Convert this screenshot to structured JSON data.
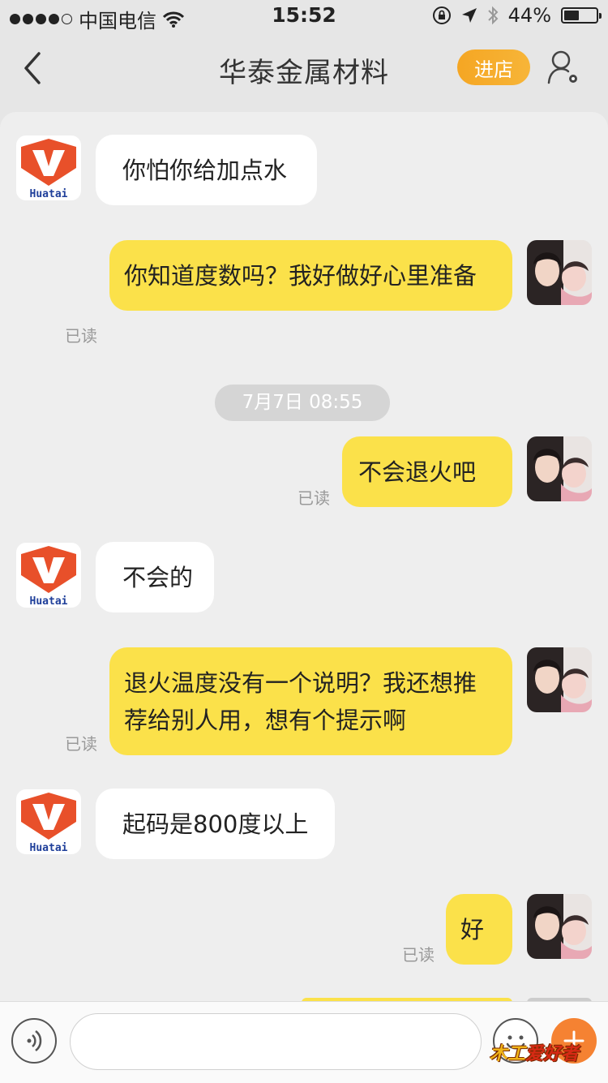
{
  "status_bar": {
    "carrier": "中国电信",
    "time": "15:52",
    "battery": "44%",
    "battery_level": 0.44
  },
  "nav": {
    "title": "华泰金属材料",
    "shop_button": "进店",
    "back_icon": "chevron-left-icon",
    "user_settings_icon": "user-settings-icon"
  },
  "shop_logo_text": "Huatai",
  "read_label": "已读",
  "timestamp": "7月7日 08:55",
  "messages": [
    {
      "side": "in",
      "text": "你怕你给加点水"
    },
    {
      "side": "out",
      "text": "你知道度数吗？我好做好心里准备",
      "read": "已读"
    },
    {
      "side": "out",
      "text": "不会退火吧",
      "read": "已读"
    },
    {
      "side": "in",
      "text": "不会的"
    },
    {
      "side": "out",
      "text": "退火温度没有一个说明？我还想推荐给别人用，想有个提示啊",
      "read": "已读"
    },
    {
      "side": "in",
      "text": "起码是800度以上"
    },
    {
      "side": "out",
      "text": "好",
      "read": "已读"
    }
  ],
  "input_bar": {
    "placeholder": "",
    "watermark_part1": "木工",
    "watermark_part2": "爱好者",
    "colors": {
      "more": "#f58232"
    }
  },
  "colors": {
    "bubble_out": "#fbe14a",
    "bubble_in": "#ffffff",
    "shop_button": "#f5a623",
    "logo_orange": "#e8502a",
    "logo_blue": "#1f3f9a"
  }
}
